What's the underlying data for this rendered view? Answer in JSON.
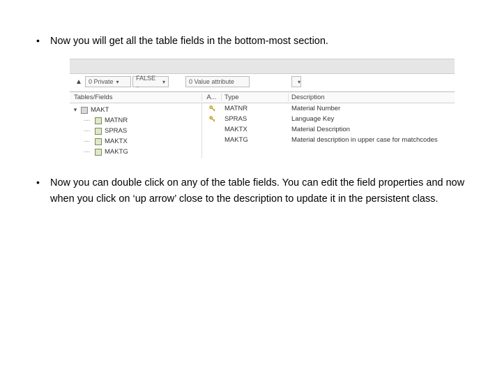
{
  "bullets": {
    "b1": "Now you will get all the table fields in the bottom-most section.",
    "b2": "Now you can double click on any of the table fields. You can edit the field properties and now when you click on ‘up arrow’ close to the description to update it in the persistent class."
  },
  "filters": {
    "visibility": "0 Private",
    "readonly": "FALSE ..",
    "attrkind": "0 Value attribute"
  },
  "columns": {
    "left": "Tables/Fields",
    "a": "A...",
    "type": "Type",
    "desc": "Description"
  },
  "tree": {
    "root": "MAKT",
    "nodes": [
      "MATNR",
      "SPRAS",
      "MAKTX",
      "MAKTG"
    ]
  },
  "rows": [
    {
      "type": "MATNR",
      "desc": "Material Number",
      "icon": "business-key"
    },
    {
      "type": "SPRAS",
      "desc": "Language Key",
      "icon": "business-key"
    },
    {
      "type": "MAKTX",
      "desc": "Material Description",
      "icon": ""
    },
    {
      "type": "MAKTG",
      "desc": "Material description in upper case for matchcodes",
      "icon": ""
    }
  ]
}
